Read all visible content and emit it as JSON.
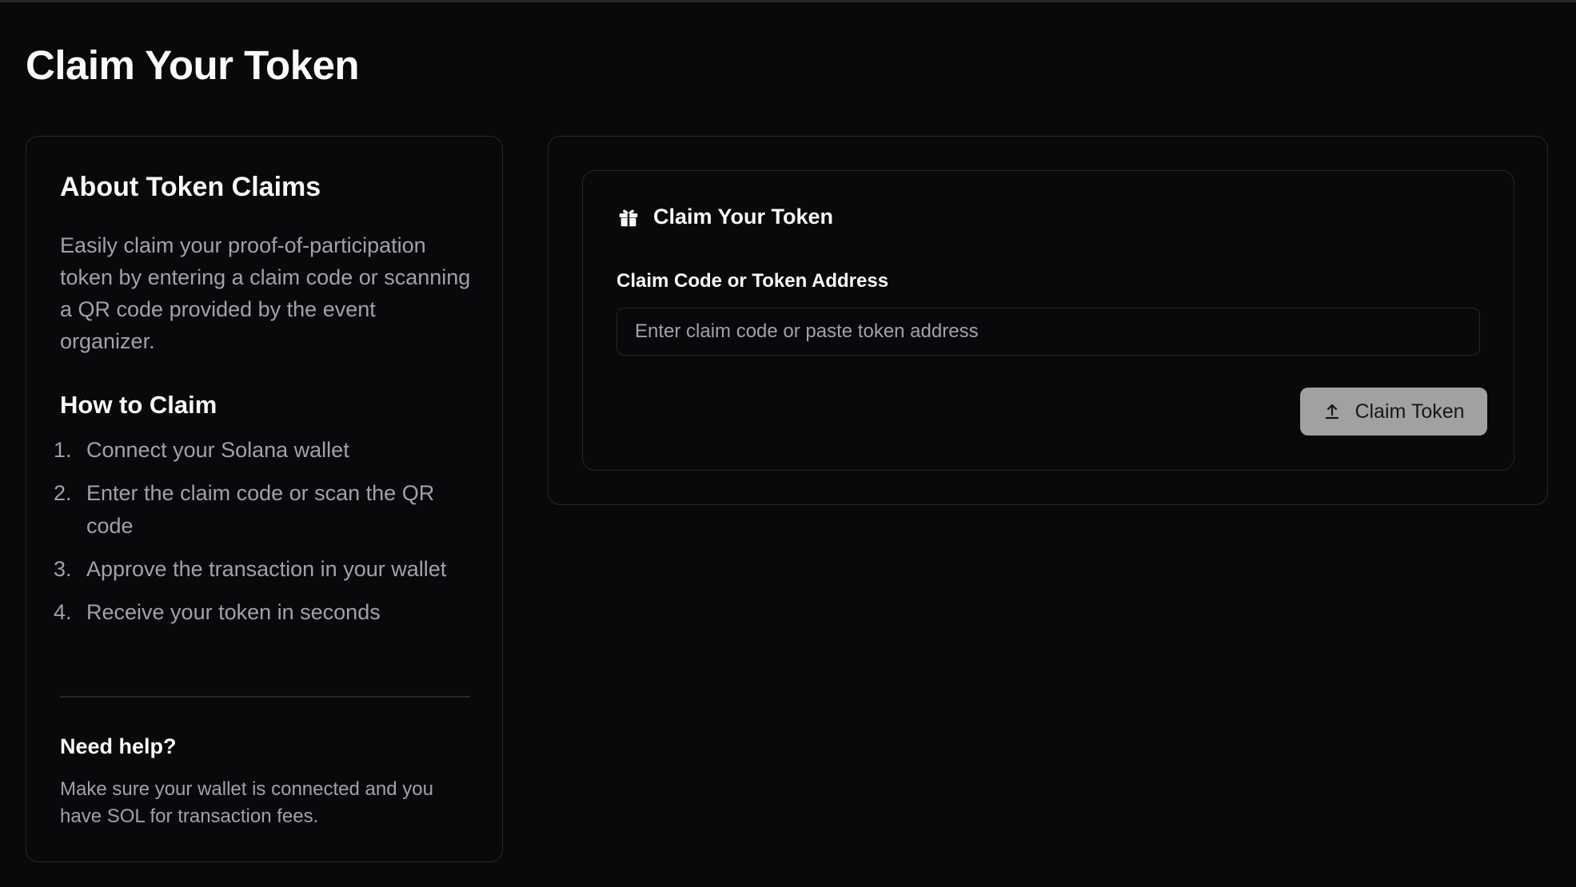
{
  "page": {
    "title": "Claim Your Token"
  },
  "info": {
    "title": "About Token Claims",
    "description": "Easily claim your proof-of-participation token by entering a claim code or scanning a QR code provided by the event organizer.",
    "howto_title": "How to Claim",
    "steps": [
      {
        "num": "1.",
        "text": "Connect your Solana wallet"
      },
      {
        "num": "2.",
        "text": "Enter the claim code or scan the QR code"
      },
      {
        "num": "3.",
        "text": "Approve the transaction in your wallet"
      },
      {
        "num": "4.",
        "text": "Receive your token in seconds"
      }
    ],
    "help_title": "Need help?",
    "help_text": "Make sure your wallet is connected and you have SOL for transaction fees."
  },
  "claim": {
    "title": "Claim Your Token",
    "icon": "gift-icon",
    "field_label": "Claim Code or Token Address",
    "input_value": "",
    "input_placeholder": "Enter claim code or paste token address",
    "button_label": "Claim Token",
    "button_icon": "upload-icon"
  },
  "colors": {
    "background": "#09090b",
    "border": "#27272a",
    "text_primary": "#fafafa",
    "text_muted": "#a1a1aa",
    "button_disabled_bg": "#a1a1a1"
  }
}
